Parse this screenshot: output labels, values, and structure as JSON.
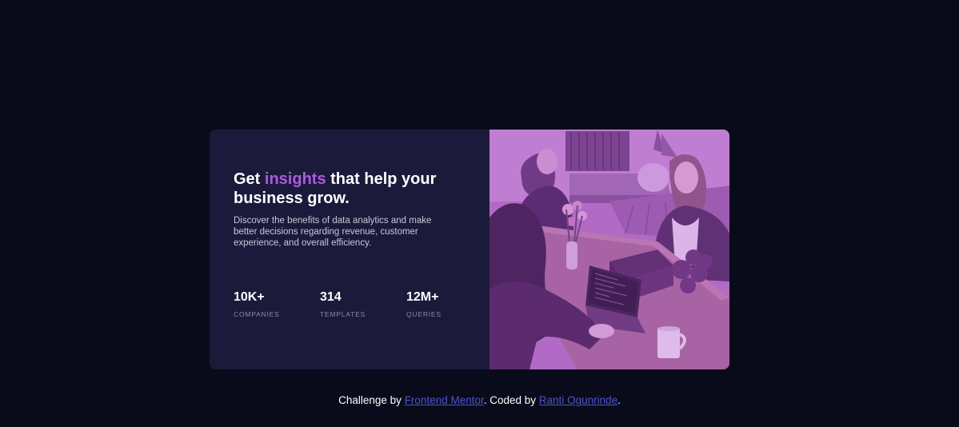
{
  "card": {
    "heading_before": "Get ",
    "heading_accent": "insights",
    "heading_after": " that help your business grow.",
    "description": "Discover the benefits of data analytics and make better decisions regarding revenue, customer experience, and overall efficiency.",
    "stats": [
      {
        "value": "10K+",
        "label": "COMPANIES"
      },
      {
        "value": "314",
        "label": "TEMPLATES"
      },
      {
        "value": "12M+",
        "label": "QUERIES"
      }
    ]
  },
  "attribution": {
    "prefix": "Challenge by ",
    "link1": "Frontend Mentor",
    "middle": ". Coded by ",
    "link2": "Ranti Ogunrinde",
    "suffix": "."
  },
  "colors": {
    "background": "#090b1a",
    "card": "#1c1a3b",
    "accent": "#a95ce0",
    "link": "#4d54c9",
    "image_tint": "#aa5cdb"
  }
}
